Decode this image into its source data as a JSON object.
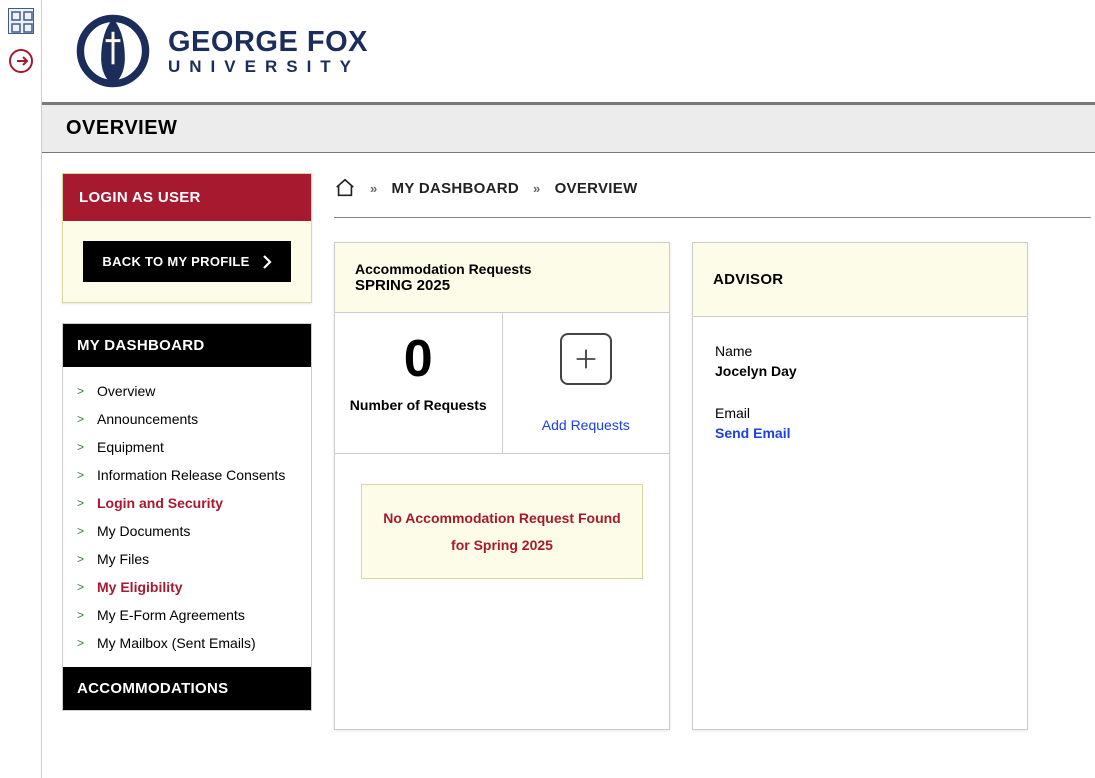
{
  "logo": {
    "line1": "GEORGE FOX",
    "line2": "UNIVERSITY"
  },
  "page_title": "OVERVIEW",
  "login_box": {
    "header": "LOGIN AS USER",
    "back_button": "BACK TO MY PROFILE"
  },
  "nav": {
    "dashboard_header": "MY DASHBOARD",
    "items": [
      {
        "label": "Overview",
        "highlight": false
      },
      {
        "label": "Announcements",
        "highlight": false
      },
      {
        "label": "Equipment",
        "highlight": false
      },
      {
        "label": "Information Release Consents",
        "highlight": false
      },
      {
        "label": "Login and Security",
        "highlight": true
      },
      {
        "label": "My Documents",
        "highlight": false
      },
      {
        "label": "My Files",
        "highlight": false
      },
      {
        "label": "My Eligibility",
        "highlight": true
      },
      {
        "label": "My E-Form Agreements",
        "highlight": false
      },
      {
        "label": "My Mailbox (Sent Emails)",
        "highlight": false
      }
    ],
    "accommodations_header": "ACCOMMODATIONS"
  },
  "breadcrumb": {
    "level1": "MY DASHBOARD",
    "level2": "OVERVIEW"
  },
  "accom_card": {
    "sub": "Accommodation Requests",
    "term": "SPRING 2025",
    "count": "0",
    "count_label": "Number of Requests",
    "add_label": "Add Requests",
    "empty_line1": "No Accommodation Request Found",
    "empty_line2": "for Spring 2025"
  },
  "advisor_card": {
    "header": "ADVISOR",
    "name_label": "Name",
    "name_value": "Jocelyn Day",
    "email_label": "Email",
    "email_link": "Send Email"
  }
}
